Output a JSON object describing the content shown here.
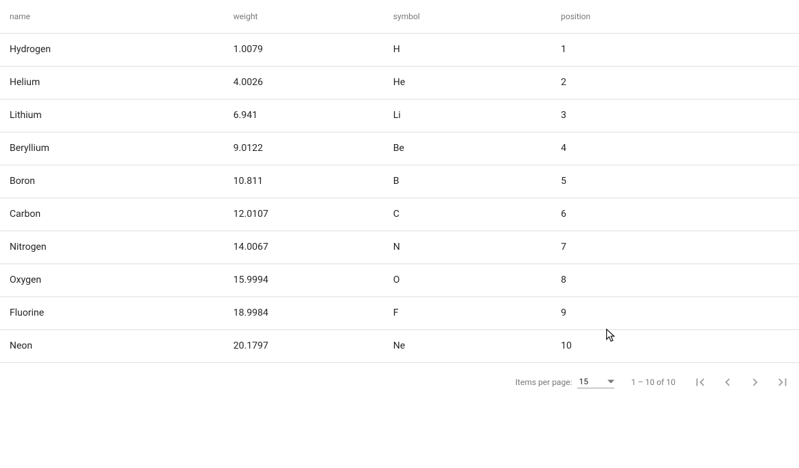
{
  "table": {
    "columns": [
      {
        "label": "name"
      },
      {
        "label": "weight"
      },
      {
        "label": "symbol"
      },
      {
        "label": "position"
      }
    ],
    "rows": [
      {
        "name": "Hydrogen",
        "weight": "1.0079",
        "symbol": "H",
        "position": "1"
      },
      {
        "name": "Helium",
        "weight": "4.0026",
        "symbol": "He",
        "position": "2"
      },
      {
        "name": "Lithium",
        "weight": "6.941",
        "symbol": "Li",
        "position": "3"
      },
      {
        "name": "Beryllium",
        "weight": "9.0122",
        "symbol": "Be",
        "position": "4"
      },
      {
        "name": "Boron",
        "weight": "10.811",
        "symbol": "B",
        "position": "5"
      },
      {
        "name": "Carbon",
        "weight": "12.0107",
        "symbol": "C",
        "position": "6"
      },
      {
        "name": "Nitrogen",
        "weight": "14.0067",
        "symbol": "N",
        "position": "7"
      },
      {
        "name": "Oxygen",
        "weight": "15.9994",
        "symbol": "O",
        "position": "8"
      },
      {
        "name": "Fluorine",
        "weight": "18.9984",
        "symbol": "F",
        "position": "9"
      },
      {
        "name": "Neon",
        "weight": "20.1797",
        "symbol": "Ne",
        "position": "10"
      }
    ]
  },
  "paginator": {
    "items_per_page_label": "Items per page:",
    "page_size": "15",
    "range_label": "1 – 10 of 10"
  }
}
